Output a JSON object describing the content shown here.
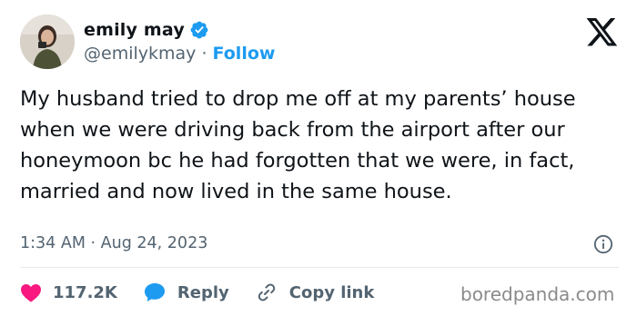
{
  "author": {
    "name": "emily may",
    "handle": "@emilykmay",
    "separator": "·",
    "follow_label": "Follow"
  },
  "tweet": {
    "text": "My husband tried to drop me off at my parents’ house when we were driving back from the airport after our honeymoon bc he had forgotten that we were, in fact, married and now lived in the same house.",
    "time": "1:34 AM",
    "date": "Aug 24, 2023",
    "meta_separator": "·"
  },
  "actions": {
    "likes_count": "117.2K",
    "reply_label": "Reply",
    "copy_link_label": "Copy link"
  },
  "watermark": "boredpanda.com",
  "colors": {
    "accent": "#1d9bf0",
    "like": "#f91880",
    "text": "#0f1419",
    "muted": "#536471"
  },
  "icons": [
    "verified-badge-icon",
    "x-logo-icon",
    "info-icon",
    "heart-icon",
    "reply-bubble-icon",
    "link-icon"
  ]
}
